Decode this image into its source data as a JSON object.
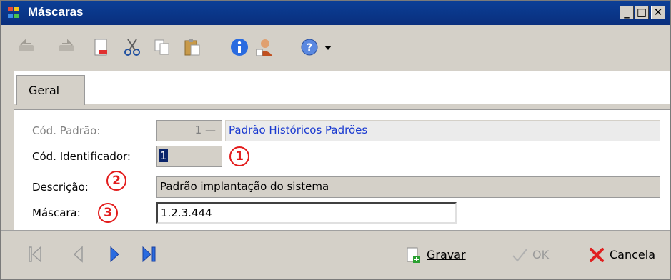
{
  "window": {
    "title": "Máscaras"
  },
  "tabs": [
    {
      "label": "Geral"
    }
  ],
  "form": {
    "cod_padrao": {
      "label": "Cód. Padrão:",
      "value": "1",
      "description": "Padrão Históricos Padrões"
    },
    "cod_identificador": {
      "label": "Cód. Identificador:",
      "value": "1"
    },
    "descricao": {
      "label": "Descrição:",
      "value": "Padrão implantação do sistema"
    },
    "mascara": {
      "label": "Máscara:",
      "value": "1.2.3.444"
    }
  },
  "annotations": [
    "1",
    "2",
    "3"
  ],
  "actions": {
    "save": "Gravar",
    "ok": "OK",
    "cancel": "Cancela"
  }
}
